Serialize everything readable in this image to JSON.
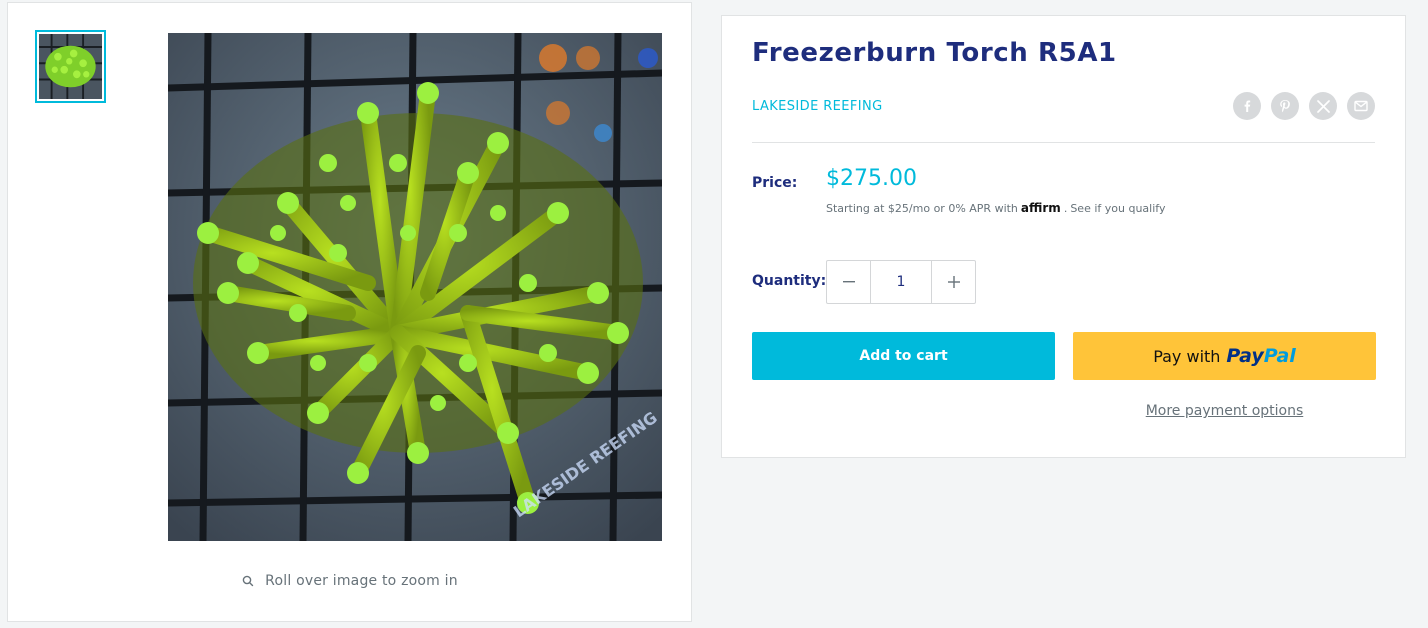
{
  "product": {
    "title": "Freezerburn Torch R5A1",
    "vendor": "LAKESIDE REEFING",
    "price_label": "Price:",
    "price": "$275.00",
    "affirm": {
      "prefix": "Starting at $25/mo or 0% APR with",
      "logo": "affirm",
      "suffix": ".",
      "link": "See if you qualify"
    },
    "quantity_label": "Quantity:",
    "quantity": "1",
    "add_to_cart": "Add to cart",
    "paypal": {
      "prefix": "Pay with",
      "logo_a": "Pay",
      "logo_b": "Pal"
    },
    "more_payment": "More payment options"
  },
  "gallery": {
    "zoom_hint": "Roll over image to zoom in",
    "image_watermark": "LAKESIDE REEFING"
  },
  "share": [
    "facebook-icon",
    "pinterest-icon",
    "x-icon",
    "email-icon"
  ],
  "colors": {
    "accent": "#00badb",
    "heading": "#1e2d7d",
    "paypal_yellow": "#ffc439",
    "text_muted": "#677279"
  }
}
